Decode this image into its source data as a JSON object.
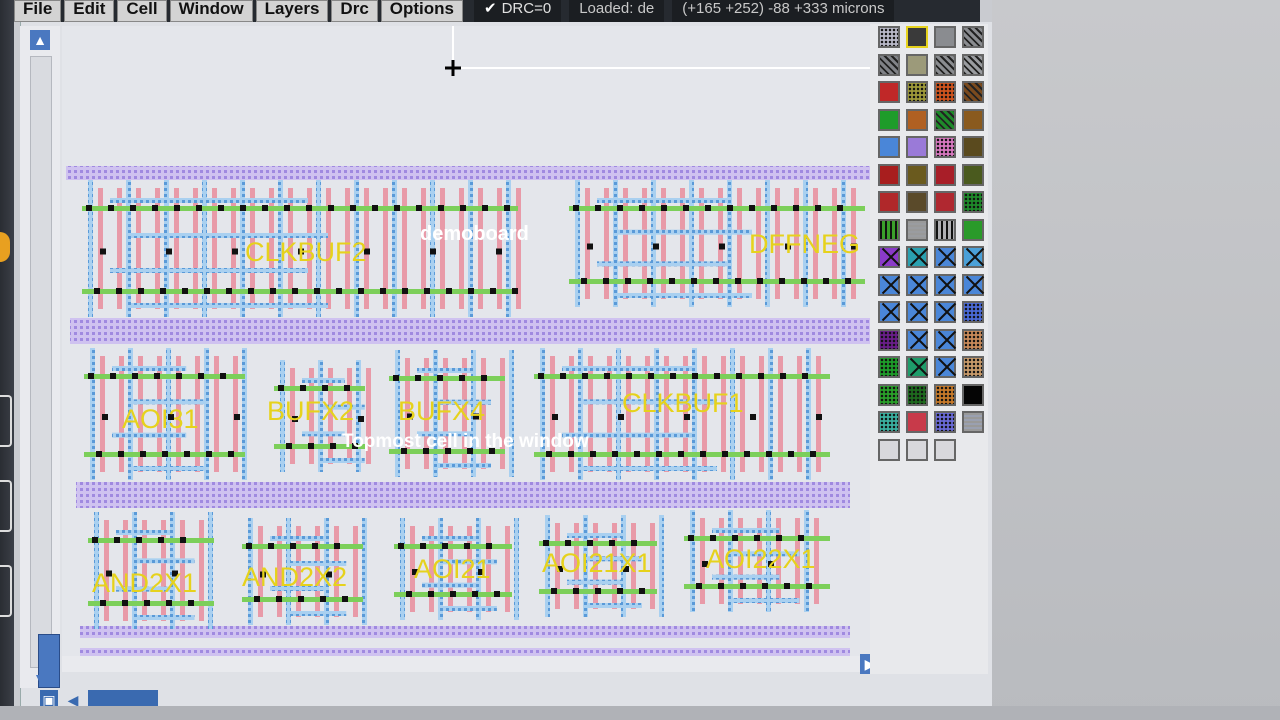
{
  "menubar": {
    "items": [
      "File",
      "Edit",
      "Cell",
      "Window",
      "Layers",
      "Drc",
      "Options"
    ],
    "drc_status": "DRC=0",
    "loaded_text": "Loaded: de",
    "coords_text": "(+165 +252) -88 +333 microns"
  },
  "layout": {
    "board_label": "demoboard",
    "topmost_label": "Topmost cell in the window",
    "cells": [
      "CLKBUF2",
      "DFFNEG",
      "AOI31",
      "BUFX2",
      "BUFX4",
      "CLKBUF1",
      "AND2X1",
      "AND2X2",
      "AOI21",
      "AOI21X1",
      "AOI22X1"
    ]
  },
  "colors": {
    "cell_label": "#e6d21c",
    "metal1": "#7fb8e8",
    "metal2": "#b7a8e8",
    "poly": "#e89aa8",
    "diffusion": "#7ccf5a",
    "contact": "#111111",
    "accent": "#4a78c0"
  },
  "icons": {
    "scroll_up": "arrow-up-icon",
    "scroll_down": "arrow-down-icon",
    "scroll_right": "arrow-right-icon",
    "scroll_left": "arrow-left-icon",
    "cursor": "crosshair-cursor-icon",
    "drc_check": "check-icon"
  },
  "palette": {
    "swatches": [
      {
        "color": "#b9b9c9",
        "style": "dots"
      },
      {
        "color": "#3a3a3a",
        "style": "yellow-border"
      },
      {
        "color": "#8a8c90",
        "style": "solid"
      },
      {
        "color": "#8a8c90",
        "style": "hatch"
      },
      {
        "color": "#808287",
        "style": "hatch"
      },
      {
        "color": "#9c9a7a",
        "style": "solid"
      },
      {
        "color": "#8a8c90",
        "style": "hatch"
      },
      {
        "color": "#9a9ca0",
        "style": "hatch"
      },
      {
        "color": "#c02828",
        "style": "solid"
      },
      {
        "color": "#9f9a3a",
        "style": "dots"
      },
      {
        "color": "#d0541e",
        "style": "dots"
      },
      {
        "color": "#7a4a1e",
        "style": "hatch"
      },
      {
        "color": "#1e9c2a",
        "style": "solid"
      },
      {
        "color": "#b06022",
        "style": "solid"
      },
      {
        "color": "#1e8a2a",
        "style": "hatch"
      },
      {
        "color": "#8a5a1e",
        "style": "solid"
      },
      {
        "color": "#4a86d8",
        "style": "solid"
      },
      {
        "color": "#9a7ad8",
        "style": "solid"
      },
      {
        "color": "#d878c0",
        "style": "dots"
      },
      {
        "color": "#5a4a1e",
        "style": "solid"
      },
      {
        "color": "#a81e1e",
        "style": "solid"
      },
      {
        "color": "#6a5a1e",
        "style": "solid"
      },
      {
        "color": "#a81e28",
        "style": "solid"
      },
      {
        "color": "#4a5a1e",
        "style": "solid"
      },
      {
        "color": "#b0282a",
        "style": "solid"
      },
      {
        "color": "#5a4a2a",
        "style": "solid"
      },
      {
        "color": "#b02830",
        "style": "solid"
      },
      {
        "color": "#1e8a2a",
        "style": "dots"
      },
      {
        "color": "#3aa02a",
        "style": "vstripe"
      },
      {
        "color": "#9a9ca0",
        "style": "hstripe"
      },
      {
        "color": "#b0b0b4",
        "style": "vstripe"
      },
      {
        "color": "#2a9a2a",
        "style": "solid"
      },
      {
        "color": "#8a3ac8",
        "style": "cross"
      },
      {
        "color": "#2aa0b0",
        "style": "cross"
      },
      {
        "color": "#4a86d8",
        "style": "cross"
      },
      {
        "color": "#4aa0d8",
        "style": "cross"
      },
      {
        "color": "#4a86d8",
        "style": "cross"
      },
      {
        "color": "#4a86d8",
        "style": "cross"
      },
      {
        "color": "#4a86d8",
        "style": "cross"
      },
      {
        "color": "#4a86d8",
        "style": "cross"
      },
      {
        "color": "#4a86d8",
        "style": "cross"
      },
      {
        "color": "#4a86d8",
        "style": "cross"
      },
      {
        "color": "#4a86d8",
        "style": "cross"
      },
      {
        "color": "#4a6ad8",
        "style": "dots"
      },
      {
        "color": "#6a1e8a",
        "style": "dots"
      },
      {
        "color": "#4a86d8",
        "style": "cross"
      },
      {
        "color": "#4a86d8",
        "style": "cross"
      },
      {
        "color": "#c88a5a",
        "style": "dots"
      },
      {
        "color": "#1e9c2a",
        "style": "dots"
      },
      {
        "color": "#1e9c6a",
        "style": "cross"
      },
      {
        "color": "#4a86d8",
        "style": "cross"
      },
      {
        "color": "#c89a6a",
        "style": "dots"
      },
      {
        "color": "#2aa02a",
        "style": "dots"
      },
      {
        "color": "#1e6a1e",
        "style": "dots"
      },
      {
        "color": "#c87a2a",
        "style": "dots"
      },
      {
        "color": "#050505",
        "style": "solid"
      },
      {
        "color": "#3ab0a0",
        "style": "dots"
      },
      {
        "color": "#c83a4a",
        "style": "solid"
      },
      {
        "color": "#6a6ad8",
        "style": "dots"
      },
      {
        "color": "#9aa0b0",
        "style": "hstripe"
      },
      {
        "color": "#d8d8dc",
        "style": "solid"
      },
      {
        "color": "#d8d8dc",
        "style": "solid"
      },
      {
        "color": "#d8d8dc",
        "style": "solid"
      }
    ]
  }
}
